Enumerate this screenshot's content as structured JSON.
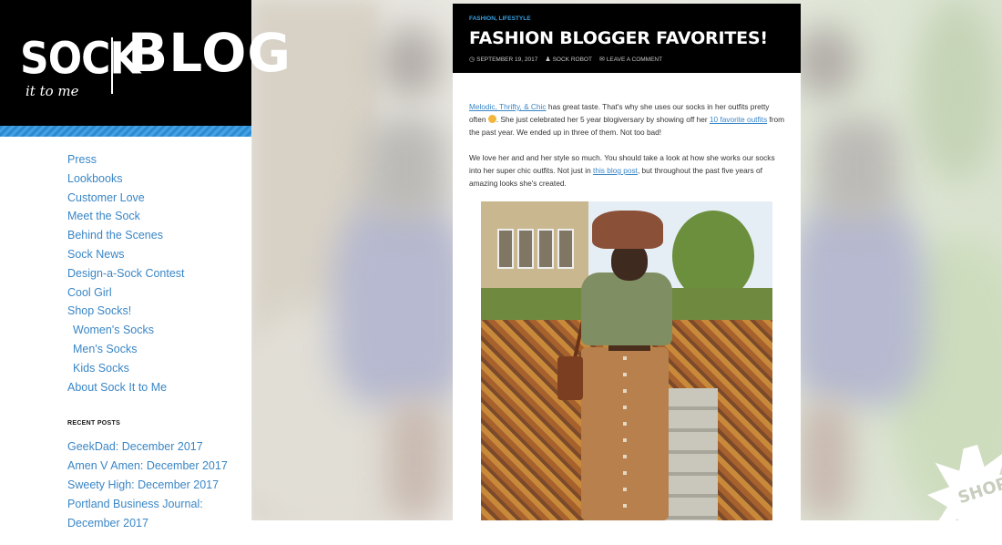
{
  "logo": {
    "word1": "SOCK",
    "tagline": "it to me",
    "word2": "BLOG"
  },
  "nav": {
    "items": [
      {
        "label": "Press",
        "sub": false
      },
      {
        "label": "Lookbooks",
        "sub": false
      },
      {
        "label": "Customer Love",
        "sub": false
      },
      {
        "label": "Meet the Sock",
        "sub": false
      },
      {
        "label": "Behind the Scenes",
        "sub": false
      },
      {
        "label": "Sock News",
        "sub": false
      },
      {
        "label": "Design-a-Sock Contest",
        "sub": false
      },
      {
        "label": "Cool Girl",
        "sub": false
      },
      {
        "label": "Shop Socks!",
        "sub": false
      },
      {
        "label": "Women's Socks",
        "sub": true
      },
      {
        "label": "Men's Socks",
        "sub": true
      },
      {
        "label": "Kids Socks",
        "sub": true
      },
      {
        "label": "About Sock It to Me",
        "sub": false
      }
    ]
  },
  "recent_posts": {
    "title": "RECENT POSTS",
    "items": [
      "GeekDad: December 2017",
      "Amen V Amen: December 2017",
      "Sweety High: December 2017",
      "Portland Business Journal: December 2017"
    ]
  },
  "post": {
    "categories": "FASHION, LIFESTYLE",
    "title": "FASHION BLOGGER FAVORITES!",
    "meta": {
      "date": "SEPTEMBER 19, 2017",
      "author": "SOCK ROBOT",
      "comment": "LEAVE A COMMENT"
    },
    "p1": {
      "link1": "Melodic, Thrifty, & Chic",
      "text1": " has great taste. That's why she uses our socks in her outfits pretty often ",
      "text2": ". She just celebrated her 5 year blogiversary by showing off her ",
      "link2": "10 favorite outfits",
      "text3": " from the past year. We ended up in three of them. Not too bad!"
    },
    "p2": {
      "text1": "We love her and and her style so much. You should take a look at how she works our socks into her super chic outfits. Not just in ",
      "link1": "this blog post",
      "text2": ", but throughout the past five years of amazing looks she's created."
    }
  },
  "shop_badge": "SHOP"
}
